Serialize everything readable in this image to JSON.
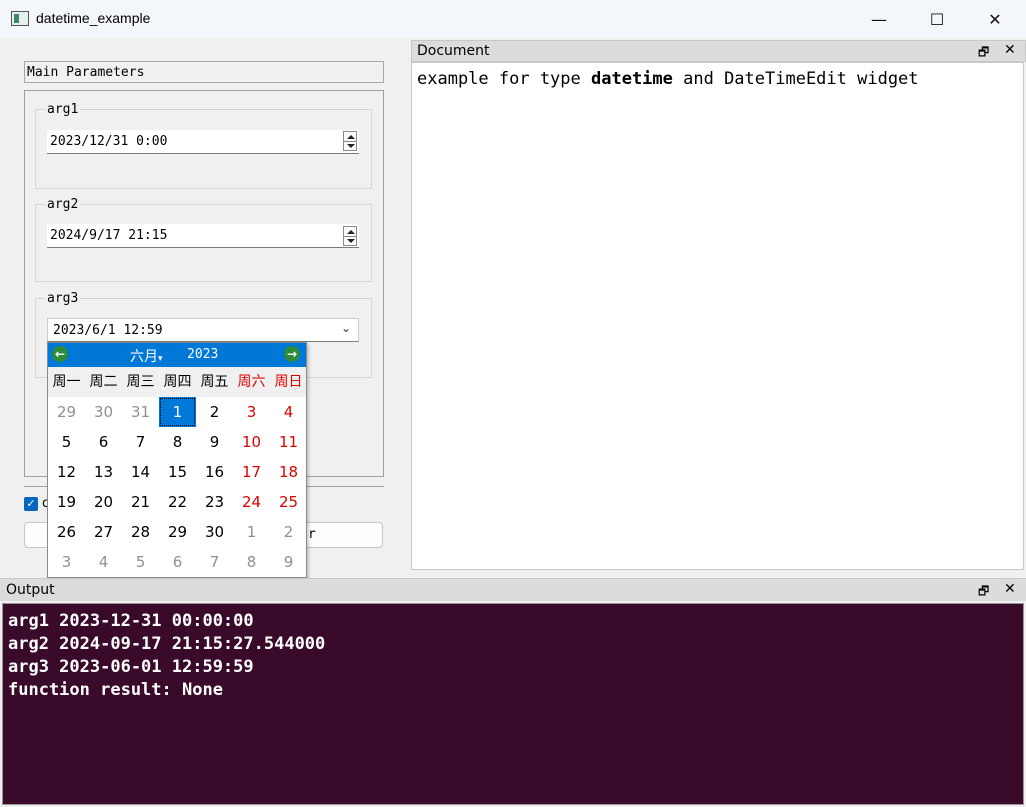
{
  "window": {
    "title": "datetime_example",
    "minimize_glyph": "—",
    "maximize_glyph": "☐",
    "close_glyph": "✕"
  },
  "left_panel": {
    "header": "Main Parameters",
    "args": [
      {
        "label": "arg1",
        "value": "2023/12/31 0:00",
        "control": "spinbox"
      },
      {
        "label": "arg2",
        "value": "2024/9/17 21:15",
        "control": "spinbox"
      },
      {
        "label": "arg3",
        "value": "2023/6/1 12:59",
        "control": "dropdown"
      }
    ],
    "checkbox_label": "c",
    "checkbox_checked": true,
    "run_button_label": "r"
  },
  "calendar": {
    "month": "六月",
    "year": "2023",
    "prev_icon": "arrow-left-icon",
    "next_icon": "arrow-right-icon",
    "weekdays": [
      "周一",
      "周二",
      "周三",
      "周四",
      "周五",
      "周六",
      "周日"
    ],
    "days": [
      [
        "29",
        "30",
        "31",
        "1",
        "2",
        "3",
        "4"
      ],
      [
        "5",
        "6",
        "7",
        "8",
        "9",
        "10",
        "11"
      ],
      [
        "12",
        "13",
        "14",
        "15",
        "16",
        "17",
        "18"
      ],
      [
        "19",
        "20",
        "21",
        "22",
        "23",
        "24",
        "25"
      ],
      [
        "26",
        "27",
        "28",
        "29",
        "30",
        "1",
        "2"
      ],
      [
        "3",
        "4",
        "5",
        "6",
        "7",
        "8",
        "9"
      ]
    ],
    "selected_day": "1",
    "weekend_color": "#e00000",
    "accent_color": "#0078d7"
  },
  "document": {
    "title": "Document",
    "text_before": "example for type ",
    "text_bold": "datetime",
    "text_after": " and DateTimeEdit widget"
  },
  "output": {
    "title": "Output",
    "lines": [
      "arg1 2023-12-31 00:00:00",
      "arg2 2024-09-17 21:15:27.544000",
      "arg3 2023-06-01 12:59:59",
      "function result: None"
    ],
    "background_color": "#3a0a2b"
  },
  "dock_buttons": {
    "float_glyph": "🗗",
    "close_glyph": "✕"
  }
}
